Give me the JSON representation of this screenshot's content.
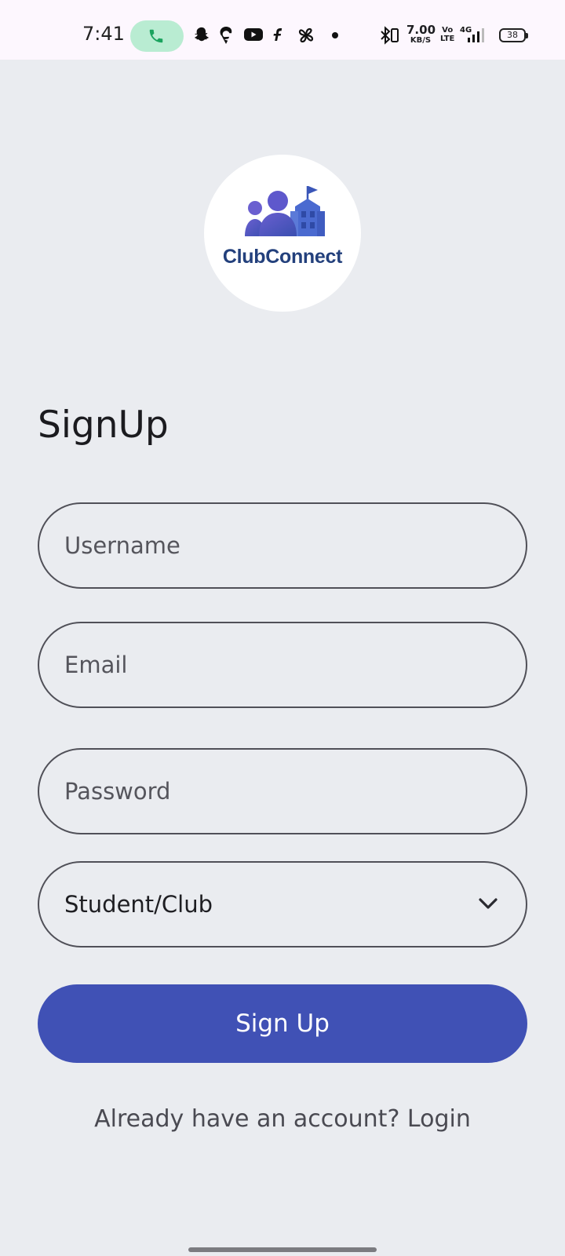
{
  "status_bar": {
    "time": "7:41",
    "network_speed_value": "7.00",
    "network_speed_unit": "KB/S",
    "volte_line1": "Vo",
    "volte_line2": "LTE",
    "network_type": "4G",
    "battery_level": "38",
    "call_pill_color": "#b9ecd2",
    "icons": [
      "phone-call-icon",
      "snapchat-icon",
      "swiggy-icon",
      "youtube-icon",
      "flipkart-icon",
      "pinwheel-icon",
      "dot-icon",
      "bluetooth-icon",
      "signal-icon",
      "battery-icon"
    ]
  },
  "logo": {
    "text": "ClubConnect",
    "brand_color": "#23407c"
  },
  "form": {
    "title": "SignUp",
    "username_placeholder": "Username",
    "email_placeholder": "Email",
    "password_placeholder": "Password",
    "role_select_value": "Student/Club",
    "submit_label": "Sign Up",
    "login_prompt": "Already have an account? Login"
  },
  "colors": {
    "background": "#eaecf0",
    "accent": "#4051b5",
    "field_border": "#505058"
  }
}
